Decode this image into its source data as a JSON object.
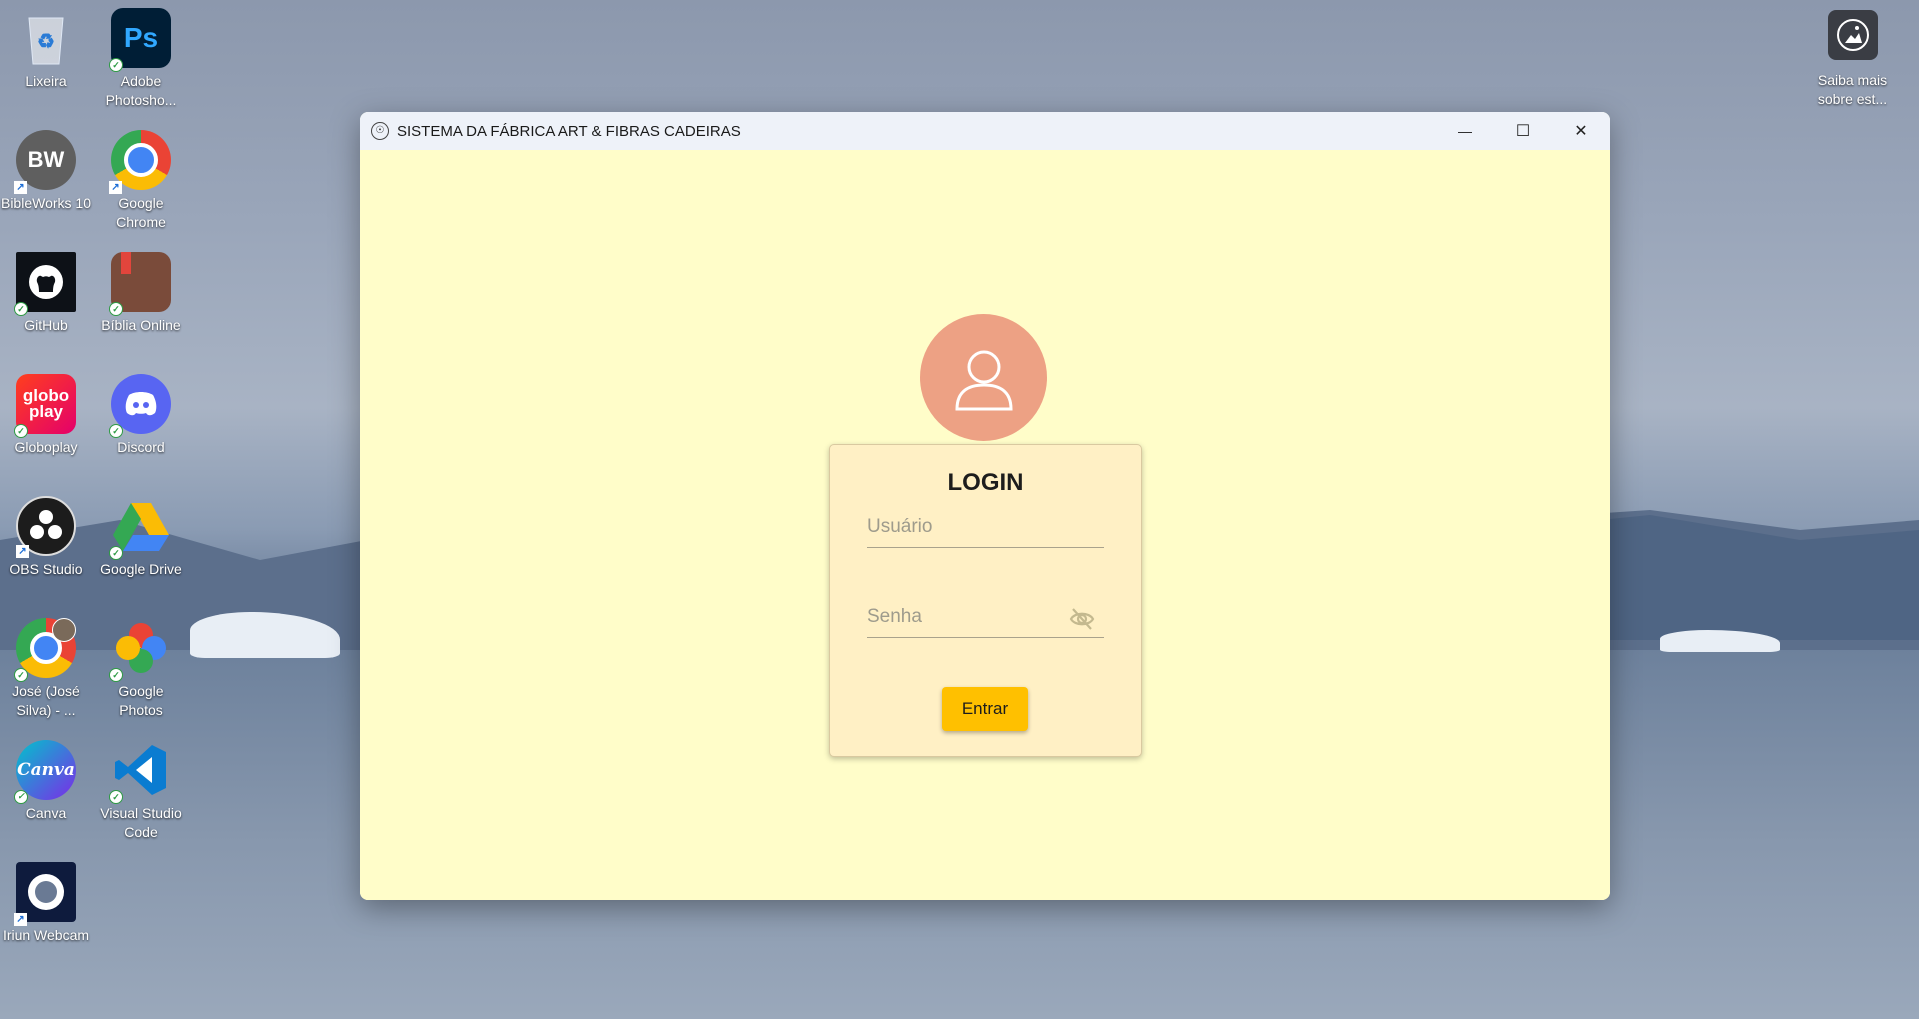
{
  "desktop": {
    "icons": [
      {
        "label": "Lixeira",
        "icon": "recycle-bin-icon"
      },
      {
        "label": "Adobe Photosho...",
        "icon": "photoshop-icon",
        "text": "Ps"
      },
      {
        "label": "BibleWorks 10",
        "icon": "bibleworks-icon",
        "text": "BW"
      },
      {
        "label": "Google Chrome",
        "icon": "chrome-icon"
      },
      {
        "label": "GitHub",
        "icon": "github-icon"
      },
      {
        "label": "Bíblia Online",
        "icon": "biblia-online-icon"
      },
      {
        "label": "Globoplay",
        "icon": "globoplay-icon",
        "text": "globo play"
      },
      {
        "label": "Discord",
        "icon": "discord-icon"
      },
      {
        "label": "OBS Studio",
        "icon": "obs-icon"
      },
      {
        "label": "Google Drive",
        "icon": "google-drive-icon"
      },
      {
        "label": "José (José Silva) - ...",
        "icon": "chrome-profile-icon"
      },
      {
        "label": "Google Photos",
        "icon": "google-photos-icon"
      },
      {
        "label": "Canva",
        "icon": "canva-icon",
        "text": "Canva"
      },
      {
        "label": "Visual Studio Code",
        "icon": "vscode-icon"
      },
      {
        "label": "Iriun Webcam",
        "icon": "iriun-webcam-icon"
      }
    ],
    "spotlight": {
      "label": "Saiba mais sobre est...",
      "icon": "spotlight-icon"
    }
  },
  "window": {
    "title": "SISTEMA DA FÁBRICA ART & FIBRAS CADEIRAS",
    "minimize": "—",
    "maximize": "☐",
    "close": "✕"
  },
  "login": {
    "title": "LOGIN",
    "username_placeholder": "Usuário",
    "username_value": "",
    "password_placeholder": "Senha",
    "password_value": "",
    "submit_label": "Entrar"
  },
  "colors": {
    "background": "#fffdc9",
    "card": "#fff0c5",
    "avatar": "#eda184",
    "button": "#ffc000"
  }
}
